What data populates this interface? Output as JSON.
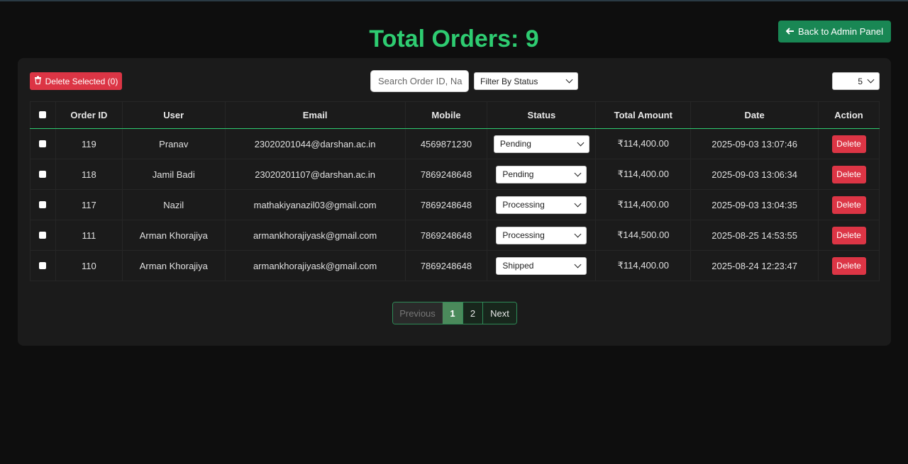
{
  "header": {
    "title": "Total Orders: 9",
    "back_label": "Back to Admin Panel"
  },
  "toolbar": {
    "delete_selected_label": "Delete Selected (0)",
    "search_placeholder": "Search Order ID, Na",
    "filter_label": "Filter By Status",
    "per_page": "5"
  },
  "table": {
    "columns": [
      "Order ID",
      "User",
      "Email",
      "Mobile",
      "Status",
      "Total Amount",
      "Date",
      "Action"
    ],
    "rows": [
      {
        "id": "119",
        "user": "Pranav",
        "email": "23020201044@darshan.ac.in",
        "mobile": "4569871230",
        "status": "Pending",
        "amount": "₹114,400.00",
        "date": "2025-09-03 13:07:46",
        "action": "Delete"
      },
      {
        "id": "118",
        "user": "Jamil Badi",
        "email": "23020201107@darshan.ac.in",
        "mobile": "7869248648",
        "status": "Pending",
        "amount": "₹114,400.00",
        "date": "2025-09-03 13:06:34",
        "action": "Delete"
      },
      {
        "id": "117",
        "user": "Nazil",
        "email": "mathakiyanazil03@gmail.com",
        "mobile": "7869248648",
        "status": "Processing",
        "amount": "₹114,400.00",
        "date": "2025-09-03 13:04:35",
        "action": "Delete"
      },
      {
        "id": "111",
        "user": "Arman Khorajiya",
        "email": "armankhorajiyask@gmail.com",
        "mobile": "7869248648",
        "status": "Processing",
        "amount": "₹144,500.00",
        "date": "2025-08-25 14:53:55",
        "action": "Delete"
      },
      {
        "id": "110",
        "user": "Arman Khorajiya",
        "email": "armankhorajiyask@gmail.com",
        "mobile": "7869248648",
        "status": "Shipped",
        "amount": "₹114,400.00",
        "date": "2025-08-24 12:23:47",
        "action": "Delete"
      }
    ]
  },
  "pagination": {
    "previous": "Previous",
    "pages": [
      "1",
      "2"
    ],
    "next": "Next"
  },
  "colors": {
    "accent": "#2ecc71",
    "danger": "#dc3545",
    "back_button": "#198754"
  }
}
